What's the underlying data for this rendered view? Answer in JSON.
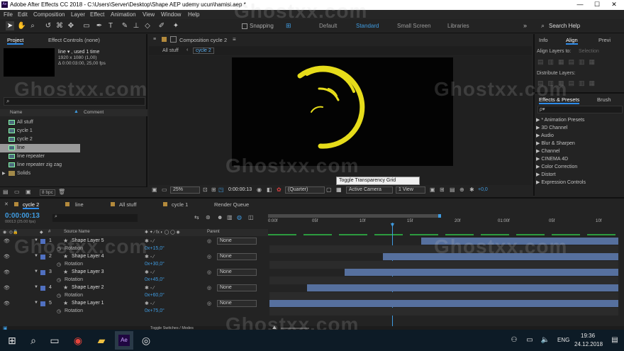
{
  "title_bar": {
    "title": "Adobe After Effects CC 2018 - C:\\Users\\Server\\Desktop\\Shape AEP udemy ucun\\hamisi.aep *",
    "minimize": "—",
    "maximize": "☐",
    "close": "✕"
  },
  "menu": [
    "File",
    "Edit",
    "Composition",
    "Layer",
    "Effect",
    "Animation",
    "View",
    "Window",
    "Help"
  ],
  "toolbar": {
    "snapping": "Snapping",
    "workspaces": [
      "Default",
      "Standard",
      "Small Screen",
      "Libraries"
    ],
    "active_workspace": "Standard",
    "search_placeholder": "Search Help"
  },
  "project_panel": {
    "tab_project": "Project",
    "tab_effect_controls": "Effect Controls (none)",
    "selected_item": "line ▾ , used 1 time",
    "info_line1": "1920 x 1080 (1,00)",
    "info_line2": "Δ 0:00:03:00, 25,00 fps",
    "col_name": "Name",
    "col_comment": "Comment",
    "items": [
      {
        "label": "All stuff",
        "selected": false
      },
      {
        "label": "cycle 1",
        "selected": false
      },
      {
        "label": "cycle 2",
        "selected": false
      },
      {
        "label": "line",
        "selected": true
      },
      {
        "label": "line repeater",
        "selected": false
      },
      {
        "label": "line repeater zig zag",
        "selected": false
      },
      {
        "label": "Solids",
        "selected": false
      }
    ],
    "bpc": "8 bpc"
  },
  "composition_panel": {
    "tab_label": "Composition cycle 2",
    "crumbs": [
      "All stuff",
      "cycle 2"
    ],
    "zoom": "25%",
    "timecode": "0:00:00:13",
    "resolution": "(Quarter)",
    "camera": "Active Camera",
    "view": "1 View",
    "exposure": "+0,0",
    "tooltip": "Toggle Transparency Grid"
  },
  "right_panel": {
    "tabs": [
      "Info",
      "Align",
      "Previ"
    ],
    "align_to": "Align Layers to:",
    "align_to_value": "Selection",
    "distribute": "Distribute Layers:",
    "effects_tab": "Effects & Presets",
    "brushes_tab": "Brush",
    "search_placeholder": "ρ▾",
    "categories": [
      "* Animation Presets",
      "3D Channel",
      "Audio",
      "Blur & Sharpen",
      "Channel",
      "CINEMA 4D",
      "Color Correction",
      "Distort",
      "Expression Controls"
    ]
  },
  "timeline": {
    "tabs": [
      "cycle 2",
      "line",
      "All stuff",
      "cycle 1",
      "Render Queue"
    ],
    "timecode": "0:00:00:13",
    "frames": "00013 (25.00 fps)",
    "col_source": "Source Name",
    "col_parent": "Parent",
    "ruler": [
      "0:00f",
      "05f",
      "10f",
      "15f",
      "20f",
      "01:00f",
      "05f",
      "10f"
    ],
    "layers": [
      {
        "num": "1",
        "name": "Shape Layer 5",
        "rotation": "0x+15,0°",
        "parent": "None"
      },
      {
        "num": "2",
        "name": "Shape Layer 4",
        "rotation": "0x+30,0°",
        "parent": "None"
      },
      {
        "num": "3",
        "name": "Shape Layer 3",
        "rotation": "0x+45,0°",
        "parent": "None"
      },
      {
        "num": "4",
        "name": "Shape Layer 2",
        "rotation": "0x+60,0°",
        "parent": "None"
      },
      {
        "num": "5",
        "name": "Shape Layer 1",
        "rotation": "0x+75,0°",
        "parent": "None"
      }
    ],
    "rotation_label": "Rotation",
    "toggle_modes": "Toggle Switches / Modes"
  },
  "taskbar": {
    "lang": "ENG",
    "time": "19:36",
    "date": "24.12.2018"
  },
  "watermark": "Ghostxx.com",
  "colors": {
    "accent": "#2d8ceb",
    "ring": "#e6dc1a",
    "layer_bar": "#56709e"
  }
}
